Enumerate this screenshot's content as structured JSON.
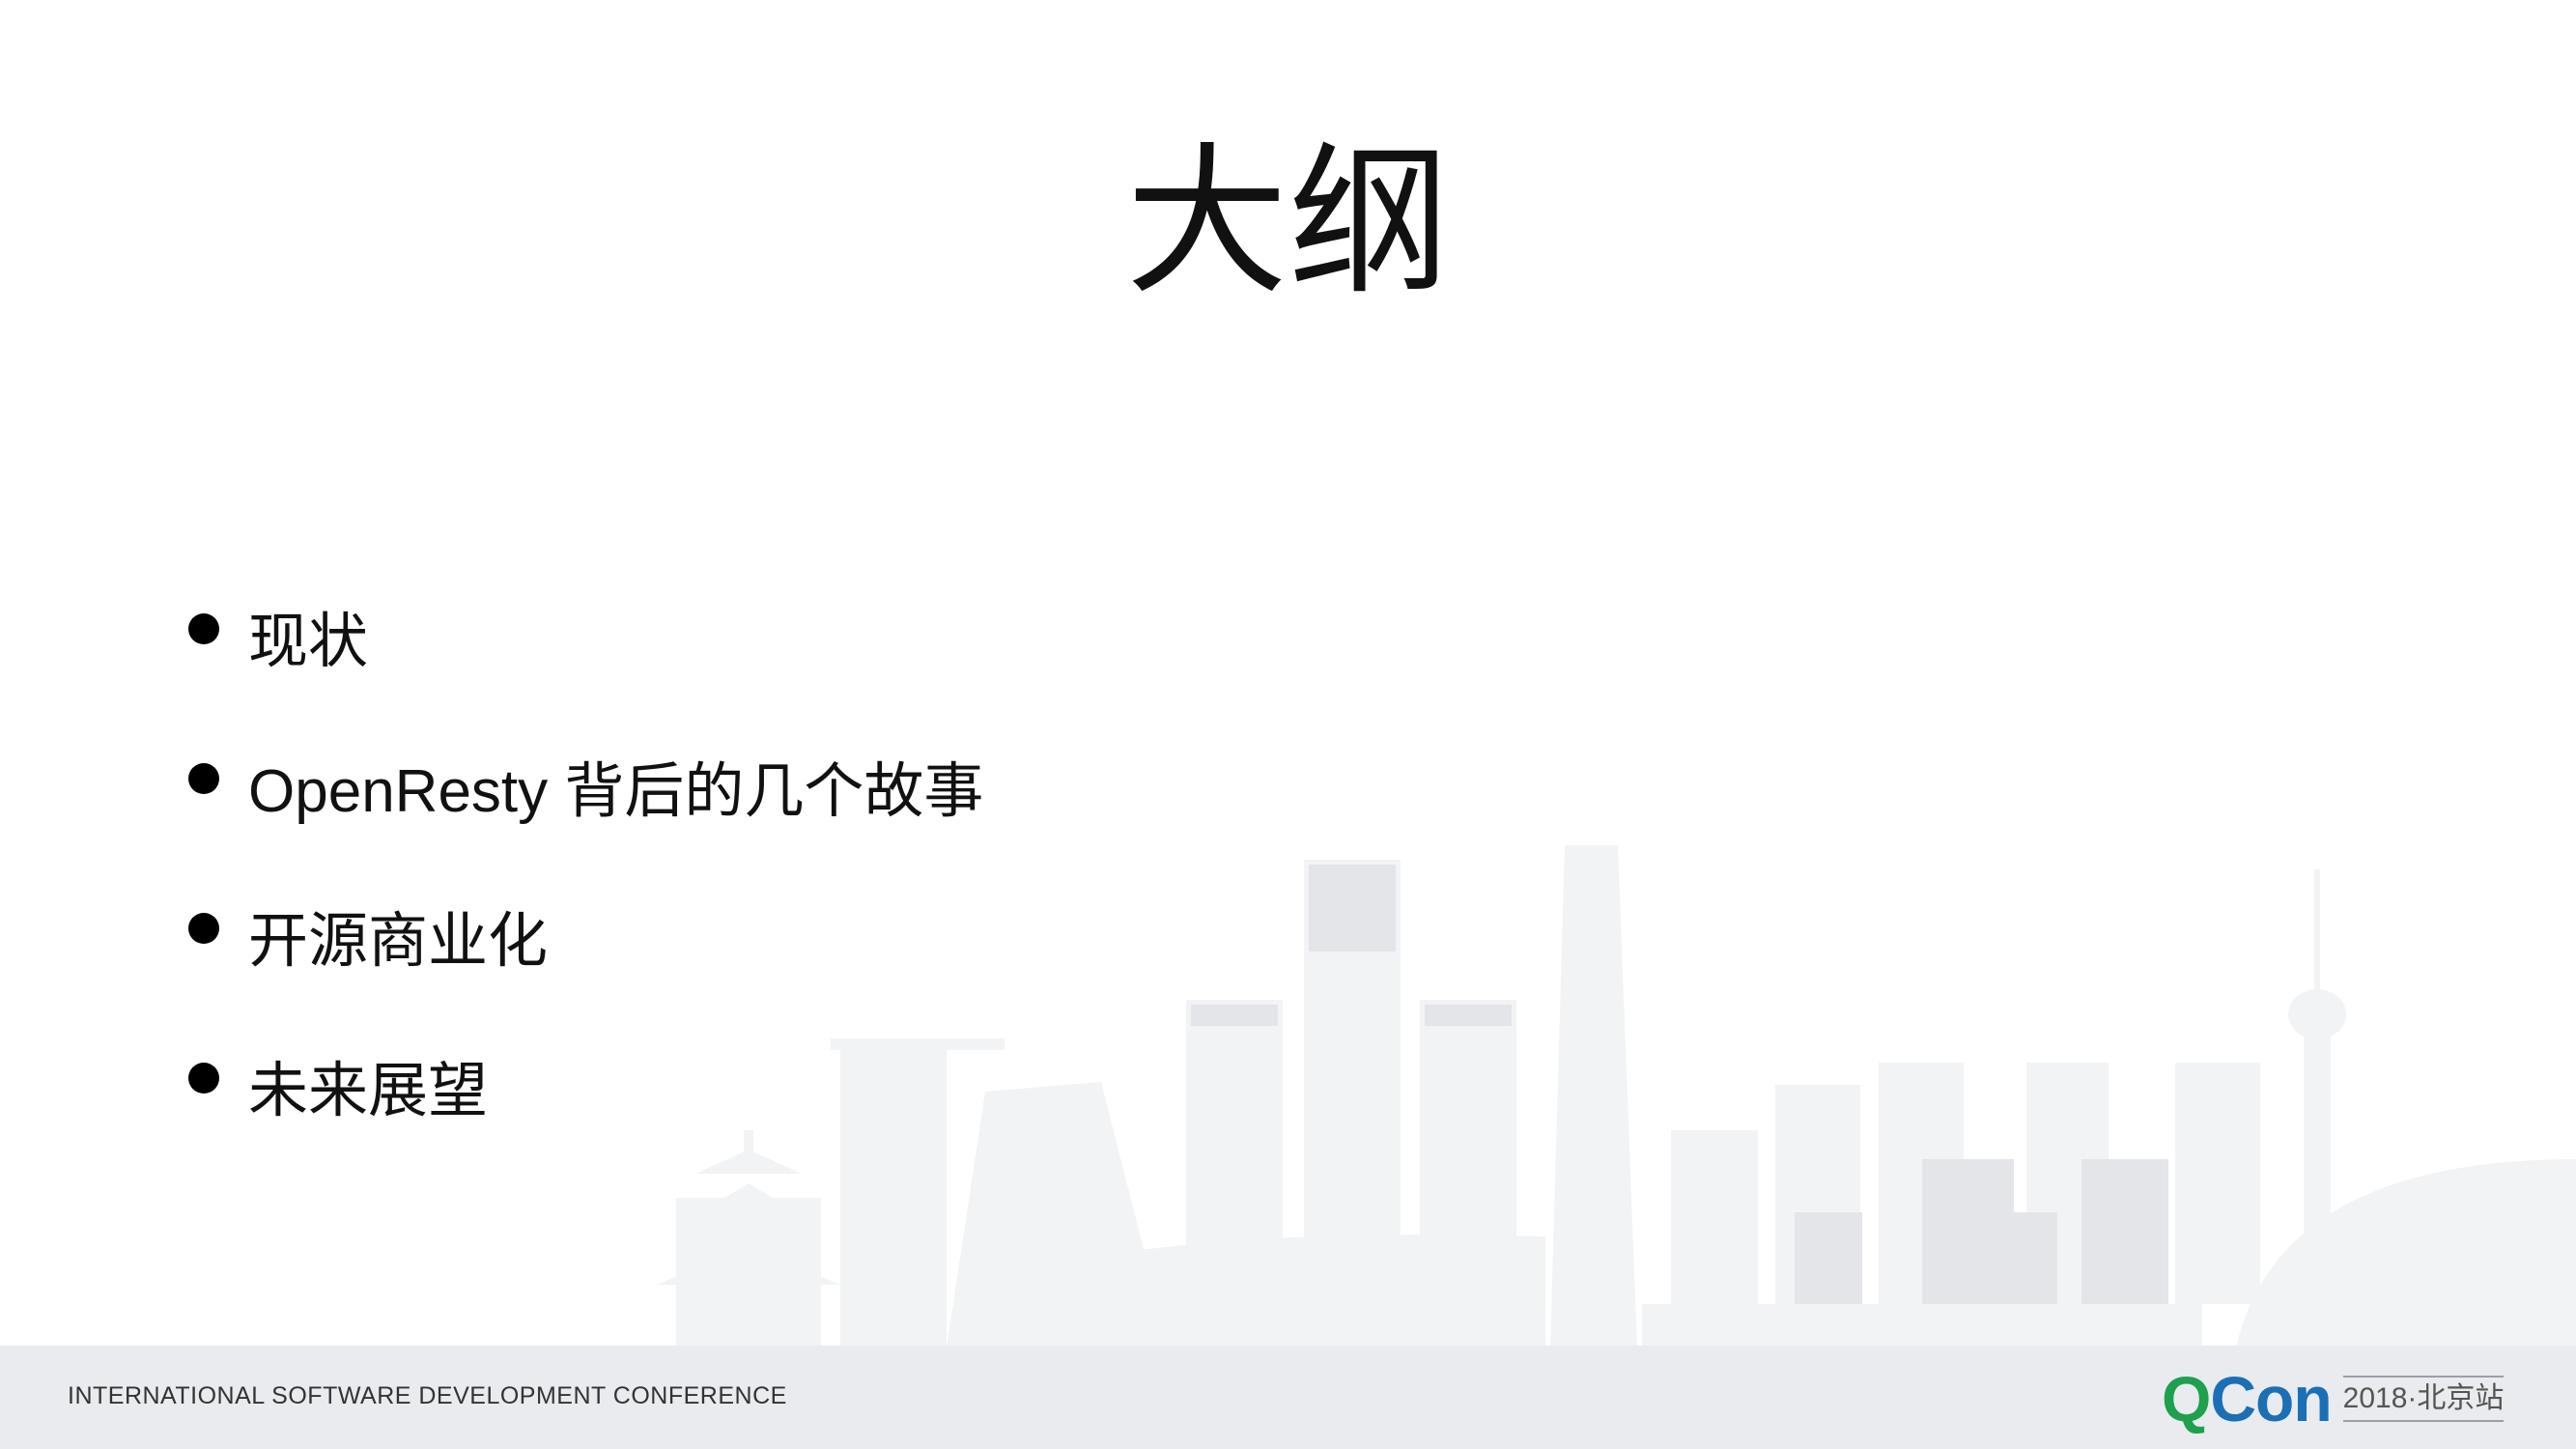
{
  "slide": {
    "title": "大纲",
    "bullets": [
      "现状",
      "OpenResty 背后的几个故事",
      "开源商业化",
      "未来展望"
    ]
  },
  "footer": {
    "conference": "INTERNATIONAL SOFTWARE DEVELOPMENT CONFERENCE",
    "brand_q": "Q",
    "brand_con": "Con",
    "edition": "2018·北京站"
  },
  "colors": {
    "skyline": "#f3f4f6",
    "footer_bg": "#e9ebee",
    "brand_green": "#1ea04e",
    "brand_blue": "#1b6fb5"
  },
  "icons": [
    "bullet-dot",
    "skyline-illustration"
  ]
}
